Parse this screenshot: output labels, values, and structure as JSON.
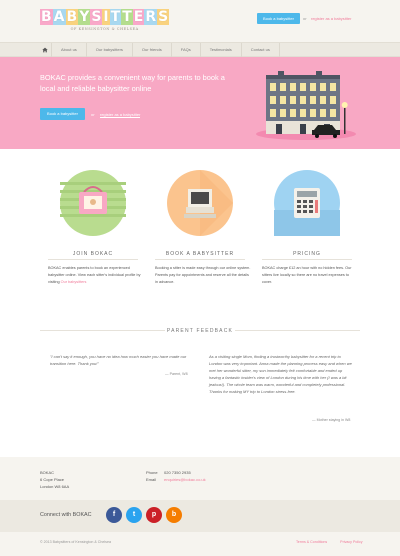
{
  "header": {
    "logo_letters": [
      "B",
      "A",
      "B",
      "Y",
      "S",
      "I",
      "T",
      "T",
      "E",
      "R",
      "S"
    ],
    "logo_colors": [
      "#f9a8c9",
      "#a8d8f0",
      "#f9d27e",
      "#b4dd8d",
      "#f9a8c9",
      "#f9d27e",
      "#a8d8f0",
      "#b4dd8d",
      "#f9a8c9",
      "#a8d8f0",
      "#f9d27e"
    ],
    "logo_subtitle": "OF KENSINGTON & CHELSEA",
    "book_button": "Book a babysitter",
    "or": "or",
    "register_link": "register as a babysitter"
  },
  "nav": {
    "items": [
      "About us",
      "Our babysitters",
      "Our friends",
      "FAQs",
      "Testimonials",
      "Contact us"
    ]
  },
  "hero": {
    "headline": "BOKAC provides a convenient way for parents to book a local and reliable babysitter online",
    "book_button": "Book a babysitter",
    "or": "or",
    "register_link": "register as a babysitter"
  },
  "features": [
    {
      "title": "JOIN BOKAC",
      "text": "BOKAC enables parents to book an experienced babysitter online. View each sitter's individual profile by visiting",
      "link": "Our babysitters",
      "color": "#b9dc8f",
      "icon": "handbag-icon"
    },
    {
      "title": "BOOK A BABYSITTER",
      "text": "Booking a sitter is made easy through our online system. Parents pay for appointments and reserve all the details in advance.",
      "link": "",
      "color": "#fbc48e",
      "icon": "computer-icon"
    },
    {
      "title": "PRICING",
      "text": "BOKAC charge £12 an hour with no hidden fees. Our sitters live locally so there are no travel expenses to cover.",
      "link": "",
      "color": "#9fd3f2",
      "icon": "calculator-icon"
    }
  ],
  "parent_feedback": {
    "title": "PARENT FEEDBACK",
    "quotes": [
      {
        "text": "\"I can't say it enough, you have no idea how much easier you have made our transition here. Thank you!\"",
        "author": "— Parent, W8"
      },
      {
        "text": "As a visiting single Mom, finding a trustworthy babysitter for a recent trip to London was very important. Anna made the planning process easy and when we met her wonderful sitter, my son immediately felt comfortable and ended up having a fantastic insider's view of London during his time with her (I was a bit jealous!). The whole team was warm, wonderful and completely professional. Thanks for making MY trip to London stress-free.",
        "author": "— Mother staying in W8"
      }
    ]
  },
  "footer": {
    "company": "BOKAC",
    "address": [
      "6 Cope Place",
      "London W8 6AA"
    ],
    "phone_label": "Phone",
    "phone": "020 7350 2935",
    "email_label": "Email",
    "email": "enquiries@bokac.co.uk",
    "connect": "Connect with BOKAC",
    "social": [
      {
        "icon": "facebook-icon",
        "glyph": "f",
        "color": "#3b5998"
      },
      {
        "icon": "twitter-icon",
        "glyph": "t",
        "color": "#2aa3ef"
      },
      {
        "icon": "pinterest-icon",
        "glyph": "p",
        "color": "#cb2027"
      },
      {
        "icon": "blogger-icon",
        "glyph": "b",
        "color": "#f57d00"
      }
    ],
    "copyright": "© 2013 Babysitters of Kensington & Chelsea",
    "links": [
      "Terms & Conditions",
      "Privacy Policy"
    ]
  }
}
